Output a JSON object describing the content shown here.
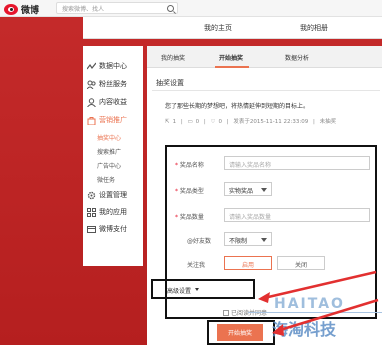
{
  "topbar": {
    "logo_text": "微博",
    "search_placeholder": "搜索微博、找人"
  },
  "header": {
    "link_home": "我的主页",
    "link_album": "我的相册"
  },
  "sidebar": {
    "items": [
      {
        "label": "数据中心",
        "icon": "chart-icon"
      },
      {
        "label": "粉丝服务",
        "icon": "fans-icon"
      },
      {
        "label": "内容收益",
        "icon": "user-icon"
      },
      {
        "label": "营销推广",
        "icon": "bag-icon"
      },
      {
        "label": "设置管理",
        "icon": "gear-icon"
      },
      {
        "label": "我的应用",
        "icon": "apps-icon"
      },
      {
        "label": "微博支付",
        "icon": "wallet-icon"
      }
    ],
    "sub_items": [
      "抽奖中心",
      "搜索推广",
      "广告中心",
      "微任务"
    ]
  },
  "tabs": [
    "我的抽奖",
    "开始抽奖",
    "数据分析"
  ],
  "settings": {
    "title": "抽奖设置",
    "intro": "您了那些长期的梦想吧，将热情延伸到短期的目标上。",
    "meta": {
      "shares": "1",
      "comments": "0",
      "likes": "0",
      "time": "发表于2015-11-11 22:33:09",
      "status": "未抽奖"
    }
  },
  "form": {
    "prize_name_label": "奖品名称",
    "prize_name_placeholder": "请输入奖品名称",
    "prize_type_label": "奖品类型",
    "prize_type_value": "实物奖品",
    "prize_count_label": "奖品数量",
    "prize_count_placeholder": "请输入奖品数量",
    "friends_label": "@好友数",
    "friends_value": "不限制",
    "follow_label": "关注我",
    "follow_on": "启用",
    "follow_off": "关闭",
    "required_mark": "*"
  },
  "advanced": {
    "label": "高级设置"
  },
  "agree": {
    "label": "已阅读并同意"
  },
  "submit": {
    "label": "开始抽奖"
  },
  "watermark": {
    "top": "HAITAO",
    "bottom": "海淘科技"
  },
  "colors": {
    "accent": "#eb7350",
    "background_red": "#c42a2a"
  }
}
